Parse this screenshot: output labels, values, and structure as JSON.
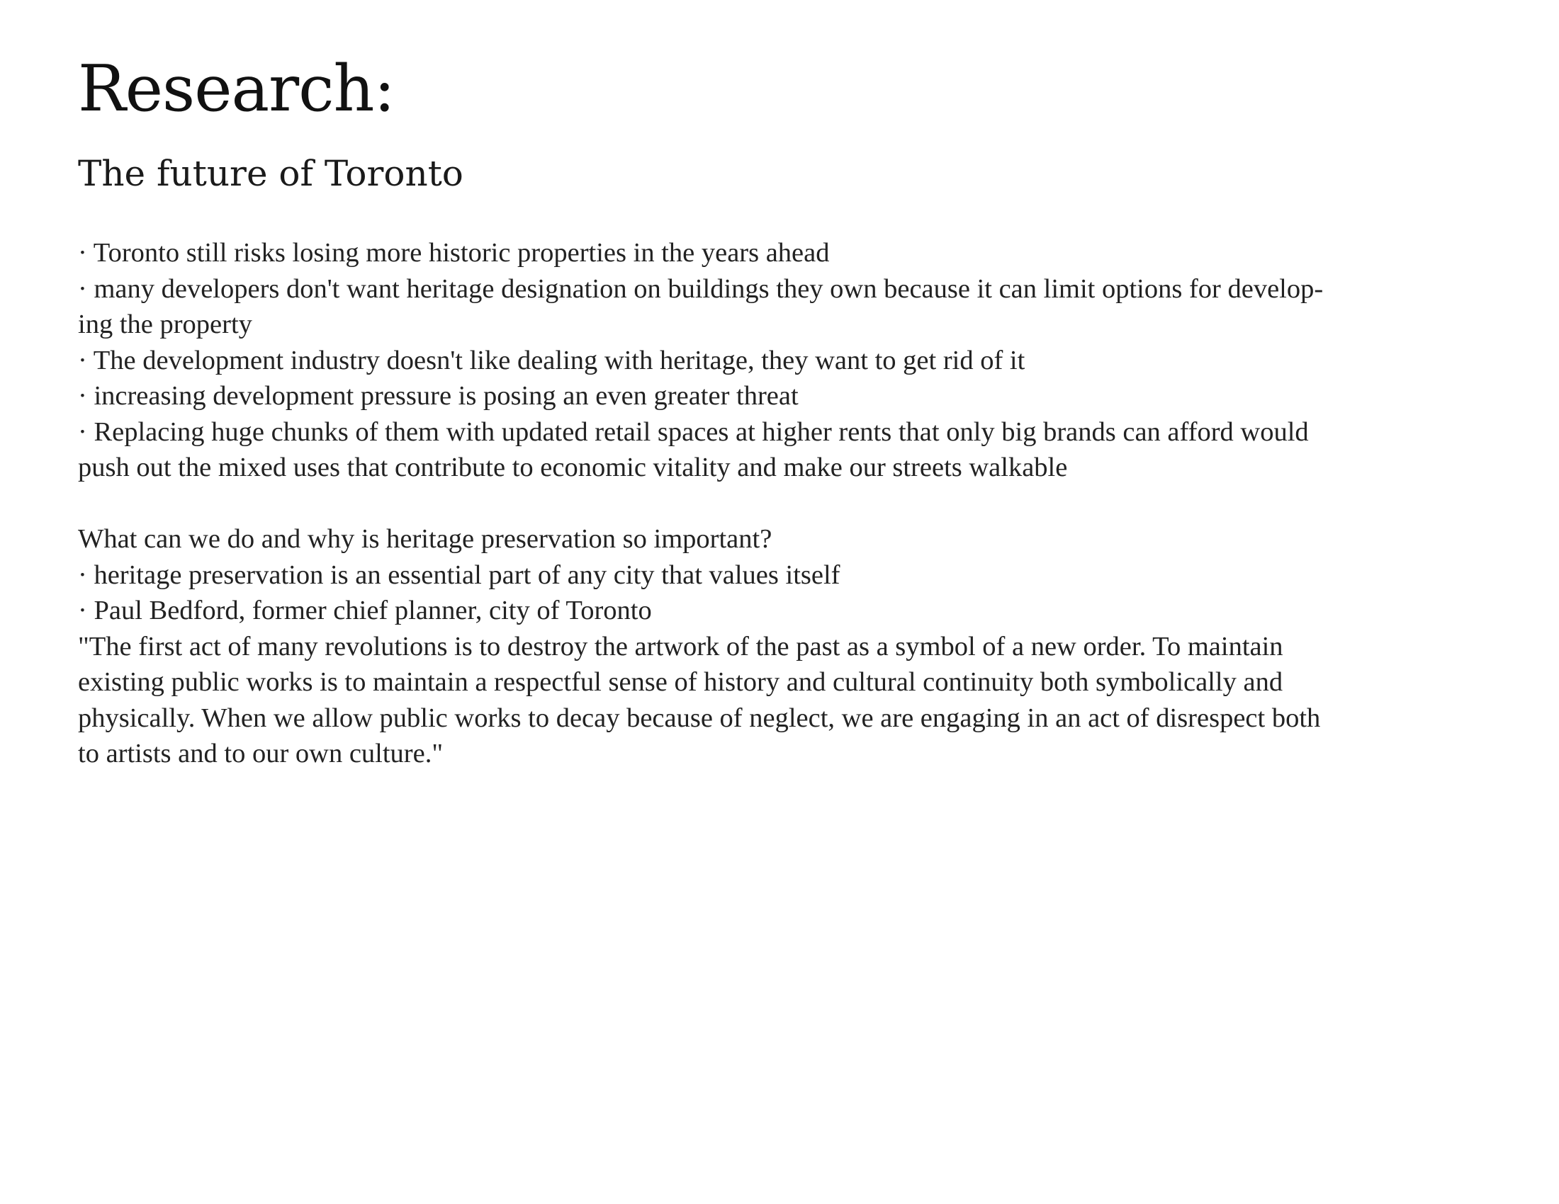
{
  "page": {
    "title": "Research:",
    "subtitle": "The future of Toronto"
  },
  "section_one": {
    "lines": [
      "· Toronto still risks losing more historic properties in the years ahead",
      "· many developers don't want heritage designation on buildings they own because it can limit options for develop-",
      "ing the property",
      "· The development industry doesn't like dealing with heritage, they want to get rid of it",
      "· increasing development pressure is posing an even greater threat",
      "· Replacing huge chunks of them with updated retail spaces at higher rents that only big brands can afford would",
      "push out the mixed uses that contribute to economic vitality and make our streets walkable"
    ]
  },
  "section_two": {
    "lines": [
      "What can we do and why is heritage preservation so important?",
      "· heritage preservation is an essential part of any city that values itself",
      "· Paul Bedford, former chief planner, city of Toronto",
      "\"The first act of many revolutions is to destroy the artwork of the past as a symbol of a new order. To maintain",
      "existing public works is to maintain a respectful sense of history and cultural continuity both symbolically and",
      "physically. When we allow public works to decay because of neglect, we are engaging in an act of disrespect both",
      "to artists and to our own culture.\""
    ]
  }
}
